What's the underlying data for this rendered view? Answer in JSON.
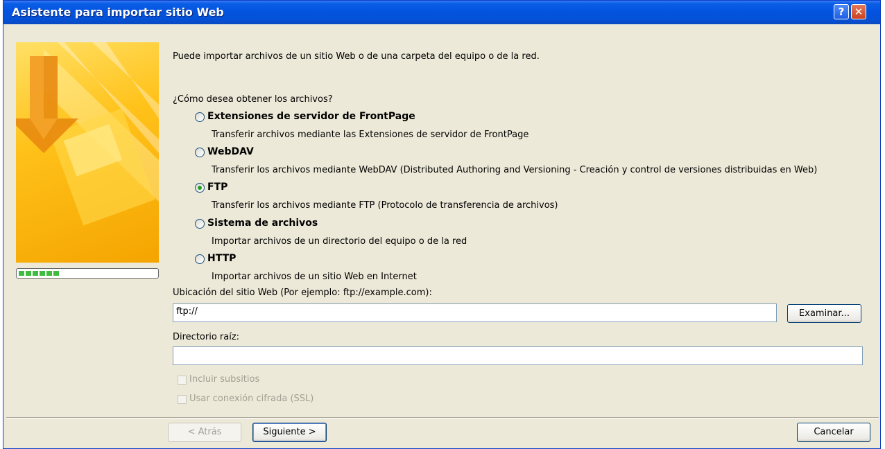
{
  "window": {
    "title": "Asistente para importar sitio Web",
    "help_glyph": "?",
    "close_glyph": "✕"
  },
  "intro": "Puede importar archivos de un sitio Web o de una carpeta del equipo o de la red.",
  "question": "¿Cómo desea obtener los archivos?",
  "options": [
    {
      "label": "Extensiones de servidor de FrontPage",
      "description": "Transferir archivos mediante las Extensiones de servidor de FrontPage",
      "selected": false
    },
    {
      "label": "WebDAV",
      "description": "Transferir los archivos mediante WebDAV (Distributed Authoring and Versioning - Creación y control de versiones distribuidas en Web)",
      "selected": false
    },
    {
      "label": "FTP",
      "description": "Transferir los archivos mediante FTP (Protocolo de transferencia de archivos)",
      "selected": true
    },
    {
      "label": "Sistema de archivos",
      "description": "Importar archivos de un directorio del equipo o de la red",
      "selected": false
    },
    {
      "label": "HTTP",
      "description": "Importar archivos de un sitio Web en Internet",
      "selected": false
    }
  ],
  "location": {
    "label": "Ubicación del sitio Web (Por ejemplo: ftp://example.com):",
    "value": "ftp://",
    "browse_label": "Examinar..."
  },
  "root_dir": {
    "label": "Directorio raíz:",
    "value": ""
  },
  "checkboxes": [
    {
      "label": "Incluir subsitios",
      "checked": false,
      "enabled": false
    },
    {
      "label": "Usar conexión cifrada (SSL)",
      "checked": false,
      "enabled": false
    }
  ],
  "buttons": {
    "back": "< Atrás",
    "next": "Siguiente >",
    "cancel": "Cancelar"
  },
  "colors": {
    "titlebar": "#0453e0",
    "dialog_bg": "#ece9d8",
    "accent_yellow": "#ffc21a",
    "radio_dot": "#21a121"
  },
  "progress": {
    "fraction": 0.3
  }
}
